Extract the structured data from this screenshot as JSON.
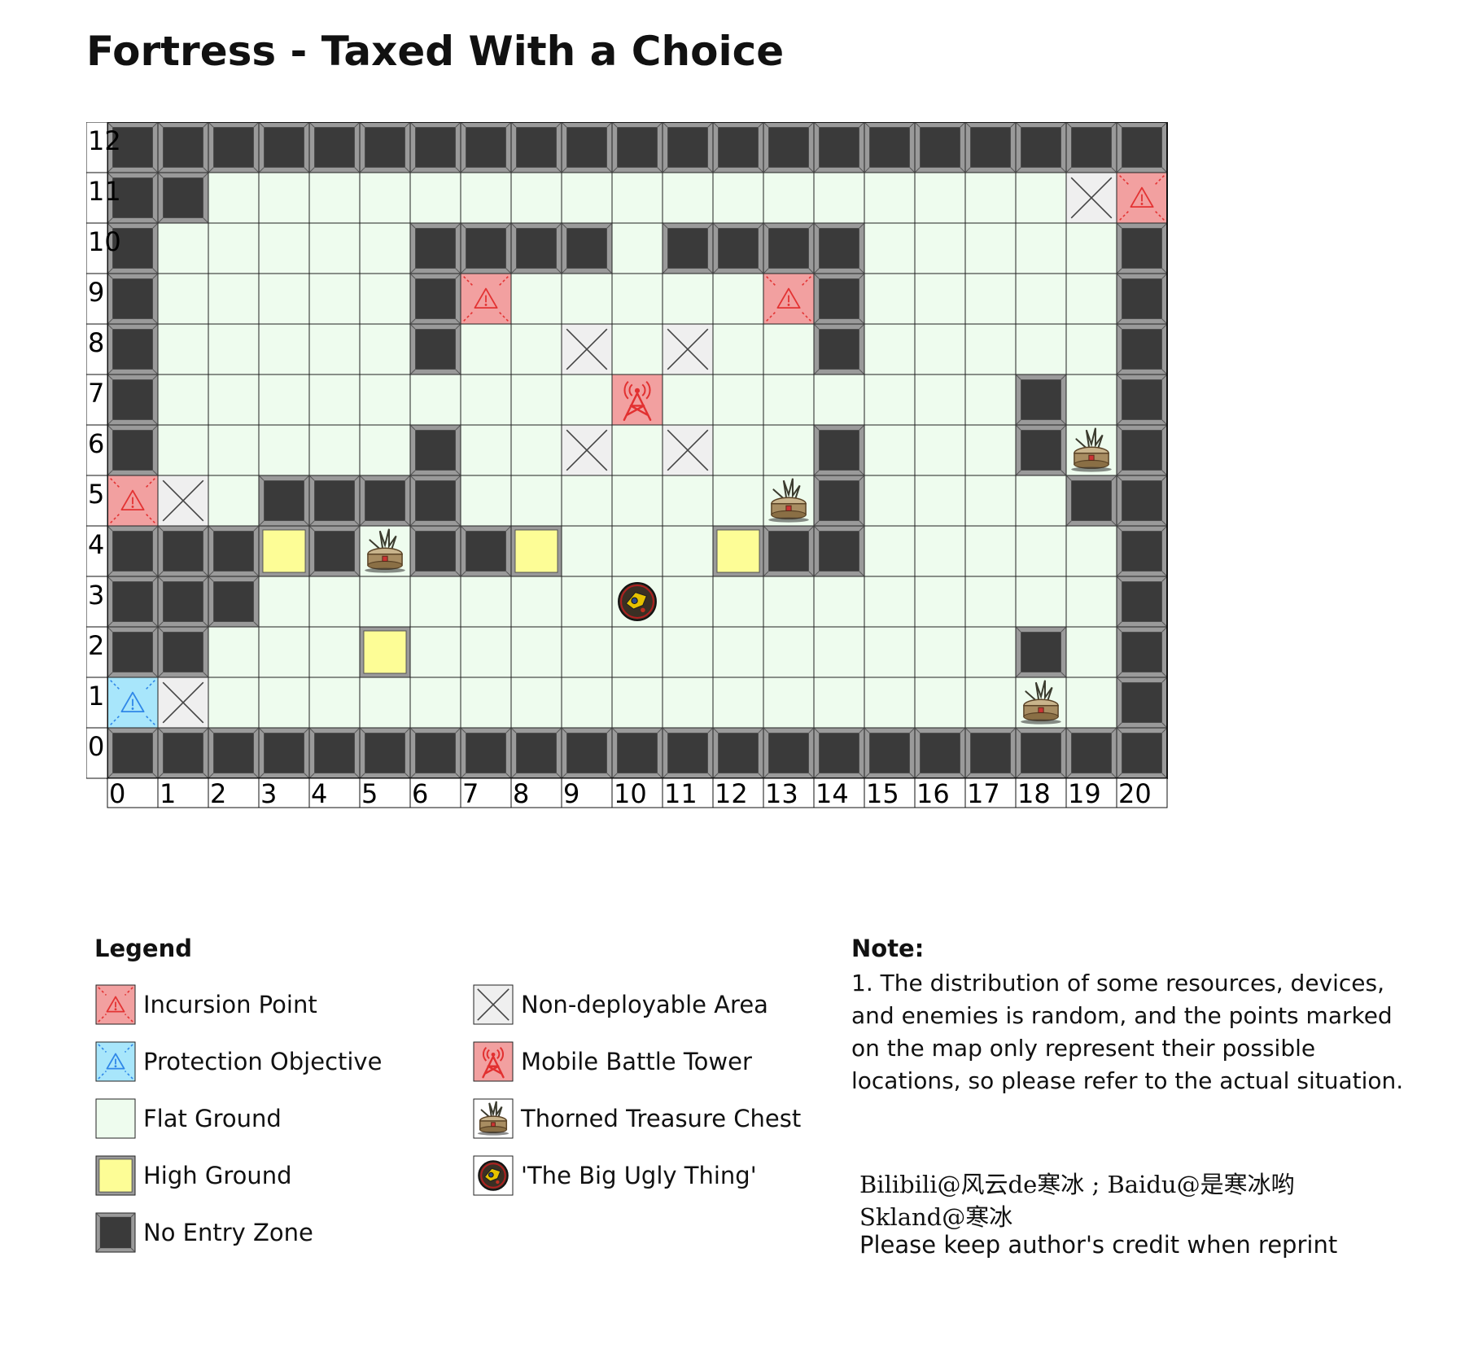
{
  "title": "Fortress - Taxed With a Choice",
  "grid": {
    "cols": 21,
    "rows": 13,
    "x_labels": [
      "0",
      "1",
      "2",
      "3",
      "4",
      "5",
      "6",
      "7",
      "8",
      "9",
      "10",
      "11",
      "12",
      "13",
      "14",
      "15",
      "16",
      "17",
      "18",
      "19",
      "20"
    ],
    "y_labels": [
      "0",
      "1",
      "2",
      "3",
      "4",
      "5",
      "6",
      "7",
      "8",
      "9",
      "10",
      "11",
      "12"
    ],
    "rows_top_to_bottom": [
      "NNNNNNNNNNNNNNNNNNNNN",
      "NNFFFFFFFFFFFFFFFFFXI",
      "NFFFFFNNNNFNNNNFFFFFN",
      "NFFFFFNIFFFFFINFFFFFN",
      "NFFFFFNFFXFXFFNFFFFFN",
      "NFFFFFFFFFFFFFFFFFNFN",
      "NFFFFFNFFXFXFFNFFFNFN",
      "IXFNNNNFFFFFFFNFFFFNN",
      "NNNHNFNNHFFFHNNFFFFFN",
      "NNNFFFFFFFFFFFFFFFFFN",
      "NNFFFHFFFFFFFFFFFFNFN",
      "PXFFFFFFFFFFFFFFFFFFN",
      "NNNNNNNNNNNNNNNNNNNNN"
    ],
    "markers": [
      {
        "type": "mobile-battle-tower",
        "x": 10,
        "y": 7
      },
      {
        "type": "thorned-treasure-chest",
        "x": 19,
        "y": 6
      },
      {
        "type": "thorned-treasure-chest",
        "x": 13,
        "y": 5
      },
      {
        "type": "thorned-treasure-chest",
        "x": 5,
        "y": 4
      },
      {
        "type": "thorned-treasure-chest",
        "x": 18,
        "y": 1
      },
      {
        "type": "big-ugly-thing",
        "x": 10,
        "y": 3
      }
    ],
    "tile_codes": {
      "N": "No Entry Zone",
      "F": "Flat Ground",
      "H": "High Ground",
      "X": "Non-deployable Area",
      "I": "Incursion Point",
      "P": "Protection Objective"
    }
  },
  "colors": {
    "flat": "#eefcee",
    "no_entry": "#3a3a3a",
    "high": "#fdfd96",
    "incursion": "#f2a0a0",
    "incursion_stroke": "#e33333",
    "protection": "#a8e6fb",
    "protection_stroke": "#2f87e8",
    "non_deployable": "#efefef",
    "tower": "#e23030"
  },
  "legend": {
    "title": "Legend",
    "items": [
      {
        "kind": "incursion",
        "label": "Incursion Point"
      },
      {
        "kind": "protection",
        "label": "Protection Objective"
      },
      {
        "kind": "flat",
        "label": "Flat Ground"
      },
      {
        "kind": "high",
        "label": "High Ground"
      },
      {
        "kind": "noentry",
        "label": "No Entry Zone"
      },
      {
        "kind": "nondeploy",
        "label": "Non-deployable Area"
      },
      {
        "kind": "tower",
        "label": "Mobile Battle Tower"
      },
      {
        "kind": "chest",
        "label": "Thorned Treasure Chest"
      },
      {
        "kind": "ugly",
        "label": "'The Big Ugly Thing'"
      }
    ]
  },
  "note": {
    "title": "Note:",
    "text": "1. The distribution of some resources, devices, and enemies is random, and the points marked on the map only represent their possible locations, so please refer to the actual situation."
  },
  "credits": {
    "line1": "Bilibili@风云de寒冰 ; Baidu@是寒冰哟",
    "line2": "Skland@寒冰",
    "line3": "Please keep author's credit when reprint"
  }
}
